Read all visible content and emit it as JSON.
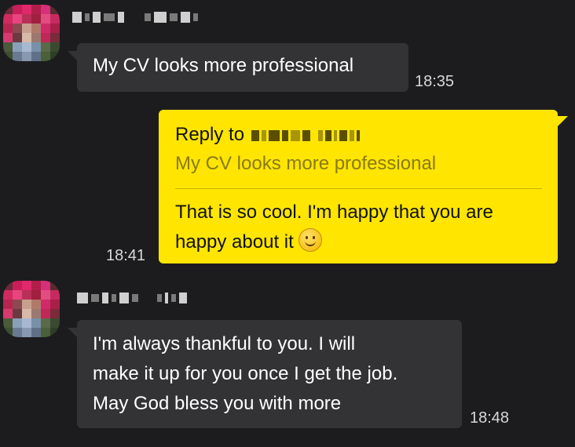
{
  "messages": [
    {
      "direction": "incoming",
      "text": "My CV looks more professional",
      "time": "18:35"
    },
    {
      "direction": "outgoing",
      "reply_label": "Reply to",
      "reply_quote": "My CV looks more professional",
      "text": "That is so cool. I'm happy that you are happy about it",
      "emoji": "slightly-smiling-face",
      "time": "18:41"
    },
    {
      "direction": "incoming",
      "text_lines": [
        "I'm always thankful to you.  I will",
        "make it up for you once I get the job.",
        "May God bless you with more"
      ],
      "time": "18:48"
    }
  ],
  "colors": {
    "background": "#1c1c1e",
    "incoming_bubble": "#333335",
    "outgoing_bubble": "#ffe500",
    "quote_text": "#8a7a16"
  }
}
